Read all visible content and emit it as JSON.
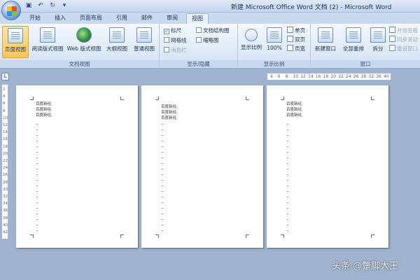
{
  "window": {
    "title": "新建 Microsoft Office Word 文档 (2) - Microsoft Word"
  },
  "quick_access": [
    "save-icon",
    "undo-icon",
    "redo-icon"
  ],
  "tabs": [
    {
      "label": "开始",
      "active": false
    },
    {
      "label": "插入",
      "active": false
    },
    {
      "label": "页面布局",
      "active": false
    },
    {
      "label": "引用",
      "active": false
    },
    {
      "label": "邮件",
      "active": false
    },
    {
      "label": "审阅",
      "active": false
    },
    {
      "label": "视图",
      "active": true
    }
  ],
  "ribbon": {
    "document_views": {
      "label": "文档视图",
      "buttons": [
        "页面视图",
        "阅读版式视图",
        "Web 版式视图",
        "大纲视图",
        "普通视图"
      ],
      "selected": "页面视图"
    },
    "show_hide": {
      "label": "显示/隐藏",
      "items": [
        {
          "label": "标尺",
          "checked": true,
          "enabled": true
        },
        {
          "label": "网格线",
          "checked": false,
          "enabled": true
        },
        {
          "label": "消息栏",
          "checked": false,
          "enabled": false
        },
        {
          "label": "文档结构图",
          "checked": false,
          "enabled": true
        },
        {
          "label": "缩略图",
          "checked": false,
          "enabled": true
        }
      ]
    },
    "zoom": {
      "label": "显示比例",
      "buttons": [
        "显示比例",
        "100%"
      ],
      "small": [
        "单页",
        "双页",
        "页宽"
      ]
    },
    "window": {
      "label": "窗口",
      "buttons": [
        "新建窗口",
        "全部重排",
        "拆分"
      ],
      "small": [
        "并排查看",
        "同步滚动",
        "重设窗口"
      ]
    }
  },
  "ruler": {
    "horizontal_ticks": [
      "4",
      "6",
      "8",
      "10",
      "12",
      "14",
      "16",
      "18",
      "20",
      "22",
      "24",
      "26",
      "28",
      "32",
      "36",
      "40"
    ],
    "vertical_ticks": [
      "2",
      "4",
      "6",
      "8",
      "10",
      "12",
      "14",
      "16",
      "18",
      "20",
      "22",
      "24",
      "26",
      "28",
      "30",
      "32",
      "34",
      "36",
      "38",
      "40",
      "42"
    ]
  },
  "pages": [
    {
      "lines": [
        "百度新经,",
        "百度新经,",
        "百度新经,"
      ]
    },
    {
      "lines": [
        "百度新经,",
        "百度新经,",
        "百度新经,"
      ]
    },
    {
      "lines": [
        "百度新经,",
        "百度新经,",
        "百度新经,"
      ]
    }
  ],
  "watermark": "头条 @蹩脚大王"
}
